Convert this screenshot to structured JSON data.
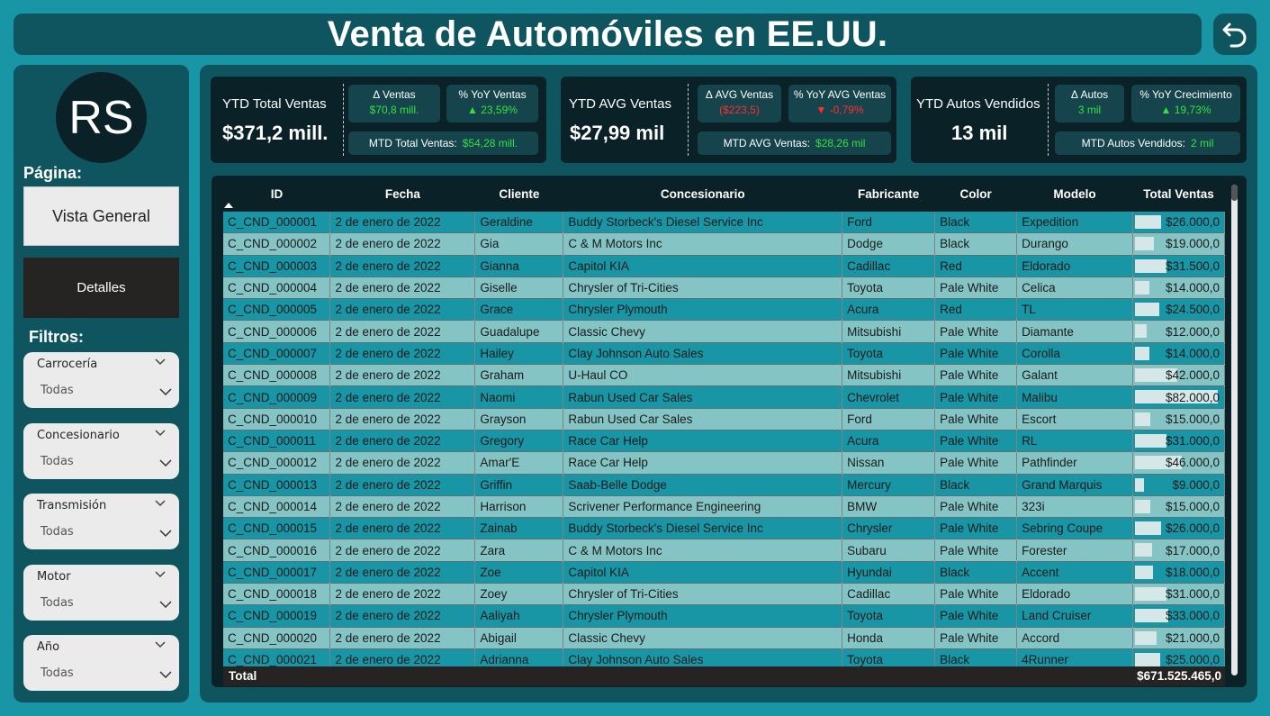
{
  "header": {
    "title": "Venta de Automóviles en EE.UU."
  },
  "sidebar": {
    "avatar_initials": "RS",
    "page_label": "Página:",
    "pages": {
      "overview": "Vista General",
      "details": "Detalles"
    },
    "filters_label": "Filtros:",
    "filters": [
      {
        "name": "Carrocería",
        "value": "Todas"
      },
      {
        "name": "Concesionario",
        "value": "Todas"
      },
      {
        "name": "Transmisión",
        "value": "Todas"
      },
      {
        "name": "Motor",
        "value": "Todas"
      },
      {
        "name": "Año",
        "value": "Todas"
      }
    ]
  },
  "kpis": {
    "sales": {
      "title": "YTD Total Ventas",
      "value": "$371,2 mill.",
      "delta_label": "Δ Ventas",
      "delta_value": "$70,8 mill.",
      "yoy_label": "% YoY Ventas",
      "yoy_value": "▲ 23,59%",
      "mtd_label": "MTD Total Ventas:",
      "mtd_value": "$54,28 mill."
    },
    "avg": {
      "title": "YTD AVG Ventas",
      "value": "$27,99 mil",
      "delta_label": "Δ AVG Ventas",
      "delta_value": "($223,5)",
      "yoy_label": "% YoY AVG Ventas",
      "yoy_value": "▼ -0,79%",
      "mtd_label": "MTD AVG Ventas:",
      "mtd_value": "$28,26 mil"
    },
    "cars": {
      "title": "YTD Autos Vendidos",
      "value": "13 mil",
      "delta_label": "Δ Autos",
      "delta_value": "3 mil",
      "yoy_label": "% YoY Crecimiento",
      "yoy_value": "▲ 19,73%",
      "mtd_label": "MTD Autos Vendidos:",
      "mtd_value": "2 mil"
    }
  },
  "table": {
    "columns": [
      "ID",
      "Fecha",
      "Cliente",
      "Concesionario",
      "Fabricante",
      "Color",
      "Modelo",
      "Total Ventas"
    ],
    "rows": [
      {
        "id": "C_CND_000001",
        "fecha": "2 de enero de 2022",
        "cliente": "Geraldine",
        "conc": "Buddy Storbeck's Diesel Service Inc",
        "fab": "Ford",
        "color": "Black",
        "modelo": "Expedition",
        "total": "$26.000,0",
        "amount": 26000
      },
      {
        "id": "C_CND_000002",
        "fecha": "2 de enero de 2022",
        "cliente": "Gia",
        "conc": "C & M Motors Inc",
        "fab": "Dodge",
        "color": "Black",
        "modelo": "Durango",
        "total": "$19.000,0",
        "amount": 19000
      },
      {
        "id": "C_CND_000003",
        "fecha": "2 de enero de 2022",
        "cliente": "Gianna",
        "conc": "Capitol KIA",
        "fab": "Cadillac",
        "color": "Red",
        "modelo": "Eldorado",
        "total": "$31.500,0",
        "amount": 31500
      },
      {
        "id": "C_CND_000004",
        "fecha": "2 de enero de 2022",
        "cliente": "Giselle",
        "conc": "Chrysler of Tri-Cities",
        "fab": "Toyota",
        "color": "Pale White",
        "modelo": "Celica",
        "total": "$14.000,0",
        "amount": 14000
      },
      {
        "id": "C_CND_000005",
        "fecha": "2 de enero de 2022",
        "cliente": "Grace",
        "conc": "Chrysler Plymouth",
        "fab": "Acura",
        "color": "Red",
        "modelo": "TL",
        "total": "$24.500,0",
        "amount": 24500
      },
      {
        "id": "C_CND_000006",
        "fecha": "2 de enero de 2022",
        "cliente": "Guadalupe",
        "conc": "Classic Chevy",
        "fab": "Mitsubishi",
        "color": "Pale White",
        "modelo": "Diamante",
        "total": "$12.000,0",
        "amount": 12000
      },
      {
        "id": "C_CND_000007",
        "fecha": "2 de enero de 2022",
        "cliente": "Hailey",
        "conc": "Clay Johnson Auto Sales",
        "fab": "Toyota",
        "color": "Pale White",
        "modelo": "Corolla",
        "total": "$14.000,0",
        "amount": 14000
      },
      {
        "id": "C_CND_000008",
        "fecha": "2 de enero de 2022",
        "cliente": "Graham",
        "conc": "U-Haul CO",
        "fab": "Mitsubishi",
        "color": "Pale White",
        "modelo": "Galant",
        "total": "$42.000,0",
        "amount": 42000
      },
      {
        "id": "C_CND_000009",
        "fecha": "2 de enero de 2022",
        "cliente": "Naomi",
        "conc": "Rabun Used Car Sales",
        "fab": "Chevrolet",
        "color": "Pale White",
        "modelo": "Malibu",
        "total": "$82.000,0",
        "amount": 82000
      },
      {
        "id": "C_CND_000010",
        "fecha": "2 de enero de 2022",
        "cliente": "Grayson",
        "conc": "Rabun Used Car Sales",
        "fab": "Ford",
        "color": "Pale White",
        "modelo": "Escort",
        "total": "$15.000,0",
        "amount": 15000
      },
      {
        "id": "C_CND_000011",
        "fecha": "2 de enero de 2022",
        "cliente": "Gregory",
        "conc": "Race Car Help",
        "fab": "Acura",
        "color": "Pale White",
        "modelo": "RL",
        "total": "$31.000,0",
        "amount": 31000
      },
      {
        "id": "C_CND_000012",
        "fecha": "2 de enero de 2022",
        "cliente": "Amar'E",
        "conc": "Race Car Help",
        "fab": "Nissan",
        "color": "Pale White",
        "modelo": "Pathfinder",
        "total": "$46.000,0",
        "amount": 46000
      },
      {
        "id": "C_CND_000013",
        "fecha": "2 de enero de 2022",
        "cliente": "Griffin",
        "conc": "Saab-Belle Dodge",
        "fab": "Mercury",
        "color": "Black",
        "modelo": "Grand Marquis",
        "total": "$9.000,0",
        "amount": 9000
      },
      {
        "id": "C_CND_000014",
        "fecha": "2 de enero de 2022",
        "cliente": "Harrison",
        "conc": "Scrivener Performance Engineering",
        "fab": "BMW",
        "color": "Pale White",
        "modelo": "323i",
        "total": "$15.000,0",
        "amount": 15000
      },
      {
        "id": "C_CND_000015",
        "fecha": "2 de enero de 2022",
        "cliente": "Zainab",
        "conc": "Buddy Storbeck's Diesel Service Inc",
        "fab": "Chrysler",
        "color": "Pale White",
        "modelo": "Sebring Coupe",
        "total": "$26.000,0",
        "amount": 26000
      },
      {
        "id": "C_CND_000016",
        "fecha": "2 de enero de 2022",
        "cliente": "Zara",
        "conc": "C & M Motors Inc",
        "fab": "Subaru",
        "color": "Pale White",
        "modelo": "Forester",
        "total": "$17.000,0",
        "amount": 17000
      },
      {
        "id": "C_CND_000017",
        "fecha": "2 de enero de 2022",
        "cliente": "Zoe",
        "conc": "Capitol KIA",
        "fab": "Hyundai",
        "color": "Black",
        "modelo": "Accent",
        "total": "$18.000,0",
        "amount": 18000
      },
      {
        "id": "C_CND_000018",
        "fecha": "2 de enero de 2022",
        "cliente": "Zoey",
        "conc": "Chrysler of Tri-Cities",
        "fab": "Cadillac",
        "color": "Pale White",
        "modelo": "Eldorado",
        "total": "$31.000,0",
        "amount": 31000
      },
      {
        "id": "C_CND_000019",
        "fecha": "2 de enero de 2022",
        "cliente": "Aaliyah",
        "conc": "Chrysler Plymouth",
        "fab": "Toyota",
        "color": "Pale White",
        "modelo": "Land Cruiser",
        "total": "$33.000,0",
        "amount": 33000
      },
      {
        "id": "C_CND_000020",
        "fecha": "2 de enero de 2022",
        "cliente": "Abigail",
        "conc": "Classic Chevy",
        "fab": "Honda",
        "color": "Pale White",
        "modelo": "Accord",
        "total": "$21.000,0",
        "amount": 21000
      },
      {
        "id": "C_CND_000021",
        "fecha": "2 de enero de 2022",
        "cliente": "Adrianna",
        "conc": "Clay Johnson Auto Sales",
        "fab": "Toyota",
        "color": "Black",
        "modelo": "4Runner",
        "total": "$25.000,0",
        "amount": 25000
      }
    ],
    "total_label": "Total",
    "total_value": "$671.525.465,0"
  },
  "colors": {
    "accent": "#1896a6",
    "panel": "#0e5560",
    "dark": "#0a2227",
    "positive": "#31e23f",
    "negative": "#ff2f2f"
  }
}
